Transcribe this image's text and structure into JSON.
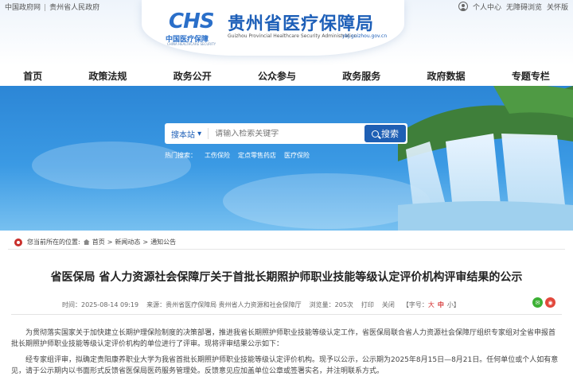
{
  "topbar": {
    "gov_link": "中国政府网",
    "province_link": "贵州省人民政府",
    "personal_center": "个人中心",
    "accessibility": "无障碍浏览",
    "care_mode": "关怀版"
  },
  "logo": {
    "mark_text": "CHS",
    "mark_cn": "中国医疗保障",
    "mark_en": "CHINA HEALTHCARE SECURITY",
    "title": "贵州省医疗保障局",
    "subtitle": "Guizhou Provincial Healthcare Security Administration",
    "domain": "ybj.guizhou.gov.cn"
  },
  "nav": {
    "items": [
      {
        "label": "首页"
      },
      {
        "label": "政策法规"
      },
      {
        "label": "政务公开"
      },
      {
        "label": "公众参与"
      },
      {
        "label": "政务服务"
      },
      {
        "label": "政府数据"
      },
      {
        "label": "专题专栏"
      }
    ]
  },
  "search": {
    "scope": "搜本站",
    "placeholder": "请输入检索关键字",
    "button": "搜索",
    "hot_label": "热门搜索：",
    "hot_items": [
      "工伤保险",
      "定点零售药店",
      "医疗保险"
    ]
  },
  "breadcrumb": {
    "label": "您当前所在的位置:",
    "items": [
      "首页",
      "新闻动态",
      "通知公告"
    ]
  },
  "article": {
    "title": "省医保局 省人力资源社会保障厅关于首批长期照护师职业技能等级认定评价机构评审结果的公示",
    "time": "时间：2025-08-14 09:19",
    "source": "来源：贵州省医疗保障局 贵州省人力资源和社会保障厅",
    "views": "浏览量：205次",
    "print": "打印",
    "close": "关闭",
    "font_label": "【字号：",
    "font_large": "大",
    "font_medium": "中",
    "font_small": "小】",
    "paragraphs": [
      "为贯彻落实国家关于加快建立长期护理保险制度的决策部署，推进我省长期照护师职业技能等级认定工作，省医保局联合省人力资源社会保障厅组织专家组对全省申报首批长期照护师职业技能等级认定评价机构的单位进行了评审。现将评审结果公示如下：",
      "经专家组评审，拟确定贵阳康养职业大学为我省首批长期照护师职业技能等级认定评价机构。现予以公示，公示期为2025年8月15日—8月21日。任何单位或个人如有意见，请于公示期内以书面形式反馈省医保局医药服务管理处。反馈意见应加盖单位公章或签署实名，并注明联系方式。"
    ]
  },
  "colors": {
    "brand_blue": "#1d5fb8",
    "banner_blue": "#2c86d6",
    "search_button": "#1e5fb4",
    "accent_red": "#d32f2f"
  }
}
